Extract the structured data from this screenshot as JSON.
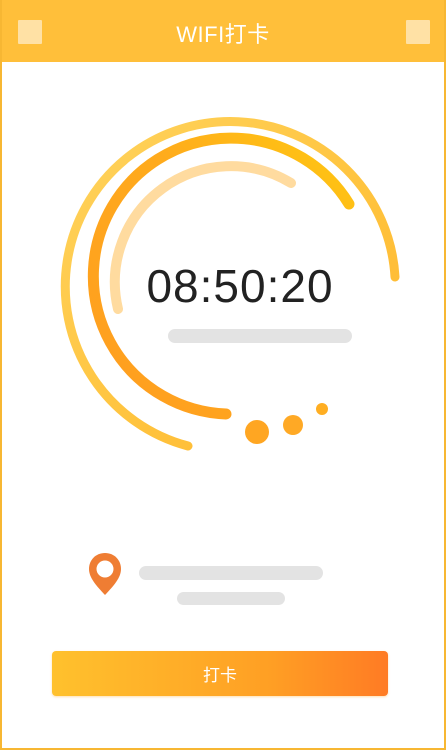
{
  "header": {
    "title": "WIFI打卡",
    "left_icon": "square-icon",
    "right_icon": "square-icon"
  },
  "clock": {
    "time": "08:50:20"
  },
  "location": {
    "icon": "location-pin-icon"
  },
  "action": {
    "button_label": "打卡"
  },
  "colors": {
    "header_background": "#ffbf3a",
    "accent_orange": "#ff9f24",
    "accent_yellow": "#ffc12d",
    "pin_orange": "#ef7d33",
    "placeholder_gray": "#e3e3e3",
    "text_dark": "#222222"
  }
}
